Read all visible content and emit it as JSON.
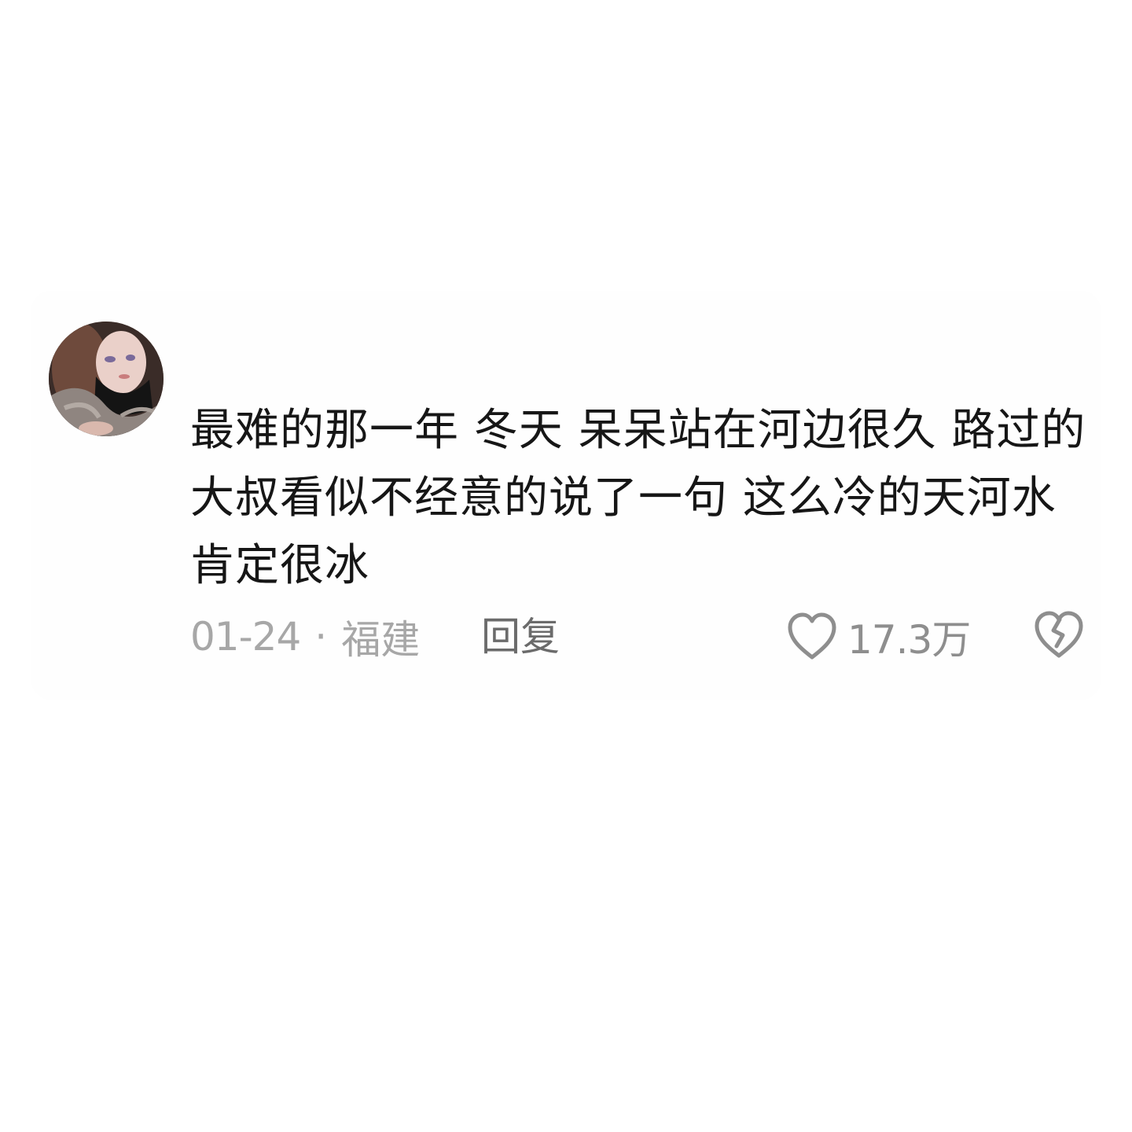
{
  "comment": {
    "text": "最难的那一年 冬天 呆呆站在河边很久 路过的大叔看似不经意的说了一句 这么冷的天河水肯定很冰",
    "date": "01-24",
    "separator": "·",
    "location": "福建",
    "reply_label": "回复",
    "like_count": "17.3万",
    "icons": {
      "like": "heart-outline-icon",
      "dislike": "broken-heart-icon"
    },
    "colors": {
      "text": "#161616",
      "meta": "#a7a7a7",
      "reply": "#6b6b6b",
      "icon": "#8e8e8e"
    }
  }
}
